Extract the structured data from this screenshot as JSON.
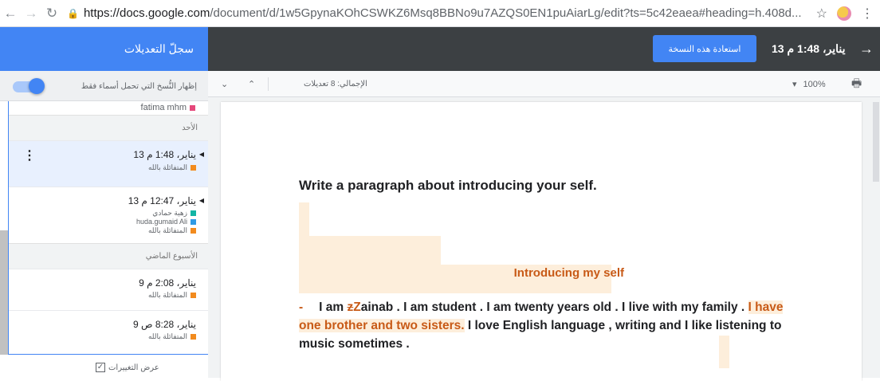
{
  "browser": {
    "url_host": "https://docs.google.com",
    "url_path": "/document/d/1w5GpynaKOhCSWKZ6Msq8BBNo9u7AZQS0EN1puAiarLg/edit?ts=5c42eaea#heading=h.408d..."
  },
  "topbar": {
    "panel_title": "سجلّ التعديلات",
    "restore_label": "استعادة هذه النسخة",
    "current_version": "13 يناير، 1:48 م"
  },
  "sidebar": {
    "toggle_label": "إظهار النُّسخ التي تحمل أسماء فقط",
    "partial_user": "fatima mhm",
    "sections": [
      "الأحد",
      "الأسبوع الماضي"
    ],
    "versions": [
      {
        "date": "13 يناير، 1:48 م",
        "users": [
          {
            "name": "المتفائلة بالله",
            "color": "#f28b1e"
          }
        ]
      },
      {
        "date": "13 يناير، 12:47 م",
        "users": [
          {
            "name": "زهية حمادي",
            "color": "#12b5a5"
          },
          {
            "name": "huda.gumaid Ali",
            "color": "#2f9be5"
          },
          {
            "name": "المتفائلة بالله",
            "color": "#f28b1e"
          }
        ]
      },
      {
        "date": "9 يناير، 2:08 م",
        "users": [
          {
            "name": "المتفائلة بالله",
            "color": "#f28b1e"
          }
        ]
      },
      {
        "date": "9 يناير، 8:28 ص",
        "users": [
          {
            "name": "المتفائلة بالله",
            "color": "#f28b1e"
          }
        ]
      }
    ],
    "show_changes_label": "عرض التغييرات"
  },
  "doctoolbar": {
    "total_label": "الإجمالي: 8 تعديلات",
    "zoom": "100%"
  },
  "document": {
    "heading": "Write a paragraph about introducing your self.",
    "subheading": "Introducing my self",
    "para_dash": "-",
    "para_start": "I am ",
    "deleted_char": "z",
    "inserted_char": "Z",
    "para_mid": "ainab . I am student . I am twenty years old  . I live with my family . ",
    "para_inserted": "I have one brother and two sisters.",
    "para_end": " I love English language , writing and I like listening to music sometimes ."
  },
  "colors": {
    "accent_blue": "#4285f4",
    "dark_bar": "#3c4043",
    "change_orange": "#c85a17",
    "change_highlight": "#fdeedb"
  }
}
